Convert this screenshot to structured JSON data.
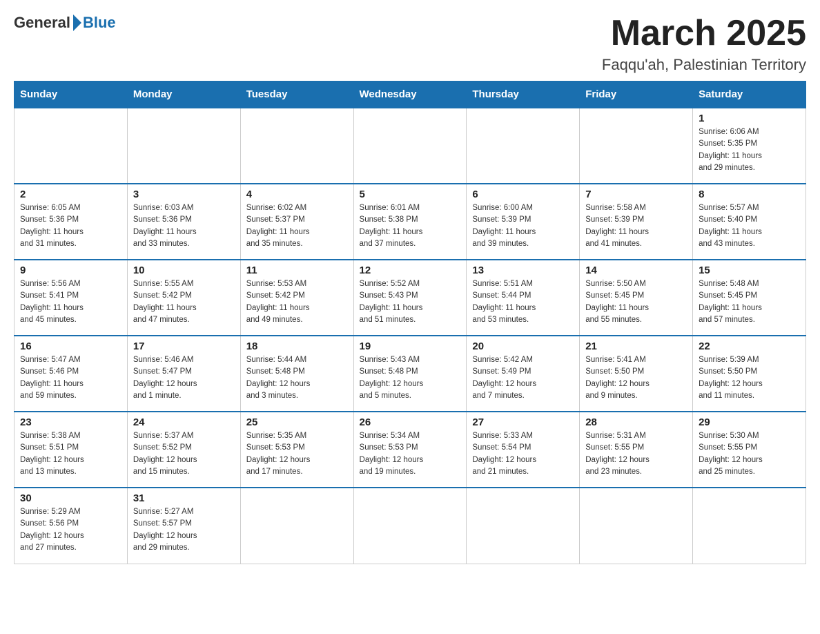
{
  "header": {
    "logo_general": "General",
    "logo_blue": "Blue",
    "month_title": "March 2025",
    "location": "Faqqu'ah, Palestinian Territory"
  },
  "weekdays": [
    "Sunday",
    "Monday",
    "Tuesday",
    "Wednesday",
    "Thursday",
    "Friday",
    "Saturday"
  ],
  "weeks": [
    [
      {
        "day": "",
        "info": ""
      },
      {
        "day": "",
        "info": ""
      },
      {
        "day": "",
        "info": ""
      },
      {
        "day": "",
        "info": ""
      },
      {
        "day": "",
        "info": ""
      },
      {
        "day": "",
        "info": ""
      },
      {
        "day": "1",
        "info": "Sunrise: 6:06 AM\nSunset: 5:35 PM\nDaylight: 11 hours\nand 29 minutes."
      }
    ],
    [
      {
        "day": "2",
        "info": "Sunrise: 6:05 AM\nSunset: 5:36 PM\nDaylight: 11 hours\nand 31 minutes."
      },
      {
        "day": "3",
        "info": "Sunrise: 6:03 AM\nSunset: 5:36 PM\nDaylight: 11 hours\nand 33 minutes."
      },
      {
        "day": "4",
        "info": "Sunrise: 6:02 AM\nSunset: 5:37 PM\nDaylight: 11 hours\nand 35 minutes."
      },
      {
        "day": "5",
        "info": "Sunrise: 6:01 AM\nSunset: 5:38 PM\nDaylight: 11 hours\nand 37 minutes."
      },
      {
        "day": "6",
        "info": "Sunrise: 6:00 AM\nSunset: 5:39 PM\nDaylight: 11 hours\nand 39 minutes."
      },
      {
        "day": "7",
        "info": "Sunrise: 5:58 AM\nSunset: 5:39 PM\nDaylight: 11 hours\nand 41 minutes."
      },
      {
        "day": "8",
        "info": "Sunrise: 5:57 AM\nSunset: 5:40 PM\nDaylight: 11 hours\nand 43 minutes."
      }
    ],
    [
      {
        "day": "9",
        "info": "Sunrise: 5:56 AM\nSunset: 5:41 PM\nDaylight: 11 hours\nand 45 minutes."
      },
      {
        "day": "10",
        "info": "Sunrise: 5:55 AM\nSunset: 5:42 PM\nDaylight: 11 hours\nand 47 minutes."
      },
      {
        "day": "11",
        "info": "Sunrise: 5:53 AM\nSunset: 5:42 PM\nDaylight: 11 hours\nand 49 minutes."
      },
      {
        "day": "12",
        "info": "Sunrise: 5:52 AM\nSunset: 5:43 PM\nDaylight: 11 hours\nand 51 minutes."
      },
      {
        "day": "13",
        "info": "Sunrise: 5:51 AM\nSunset: 5:44 PM\nDaylight: 11 hours\nand 53 minutes."
      },
      {
        "day": "14",
        "info": "Sunrise: 5:50 AM\nSunset: 5:45 PM\nDaylight: 11 hours\nand 55 minutes."
      },
      {
        "day": "15",
        "info": "Sunrise: 5:48 AM\nSunset: 5:45 PM\nDaylight: 11 hours\nand 57 minutes."
      }
    ],
    [
      {
        "day": "16",
        "info": "Sunrise: 5:47 AM\nSunset: 5:46 PM\nDaylight: 11 hours\nand 59 minutes."
      },
      {
        "day": "17",
        "info": "Sunrise: 5:46 AM\nSunset: 5:47 PM\nDaylight: 12 hours\nand 1 minute."
      },
      {
        "day": "18",
        "info": "Sunrise: 5:44 AM\nSunset: 5:48 PM\nDaylight: 12 hours\nand 3 minutes."
      },
      {
        "day": "19",
        "info": "Sunrise: 5:43 AM\nSunset: 5:48 PM\nDaylight: 12 hours\nand 5 minutes."
      },
      {
        "day": "20",
        "info": "Sunrise: 5:42 AM\nSunset: 5:49 PM\nDaylight: 12 hours\nand 7 minutes."
      },
      {
        "day": "21",
        "info": "Sunrise: 5:41 AM\nSunset: 5:50 PM\nDaylight: 12 hours\nand 9 minutes."
      },
      {
        "day": "22",
        "info": "Sunrise: 5:39 AM\nSunset: 5:50 PM\nDaylight: 12 hours\nand 11 minutes."
      }
    ],
    [
      {
        "day": "23",
        "info": "Sunrise: 5:38 AM\nSunset: 5:51 PM\nDaylight: 12 hours\nand 13 minutes."
      },
      {
        "day": "24",
        "info": "Sunrise: 5:37 AM\nSunset: 5:52 PM\nDaylight: 12 hours\nand 15 minutes."
      },
      {
        "day": "25",
        "info": "Sunrise: 5:35 AM\nSunset: 5:53 PM\nDaylight: 12 hours\nand 17 minutes."
      },
      {
        "day": "26",
        "info": "Sunrise: 5:34 AM\nSunset: 5:53 PM\nDaylight: 12 hours\nand 19 minutes."
      },
      {
        "day": "27",
        "info": "Sunrise: 5:33 AM\nSunset: 5:54 PM\nDaylight: 12 hours\nand 21 minutes."
      },
      {
        "day": "28",
        "info": "Sunrise: 5:31 AM\nSunset: 5:55 PM\nDaylight: 12 hours\nand 23 minutes."
      },
      {
        "day": "29",
        "info": "Sunrise: 5:30 AM\nSunset: 5:55 PM\nDaylight: 12 hours\nand 25 minutes."
      }
    ],
    [
      {
        "day": "30",
        "info": "Sunrise: 5:29 AM\nSunset: 5:56 PM\nDaylight: 12 hours\nand 27 minutes."
      },
      {
        "day": "31",
        "info": "Sunrise: 5:27 AM\nSunset: 5:57 PM\nDaylight: 12 hours\nand 29 minutes."
      },
      {
        "day": "",
        "info": ""
      },
      {
        "day": "",
        "info": ""
      },
      {
        "day": "",
        "info": ""
      },
      {
        "day": "",
        "info": ""
      },
      {
        "day": "",
        "info": ""
      }
    ]
  ]
}
